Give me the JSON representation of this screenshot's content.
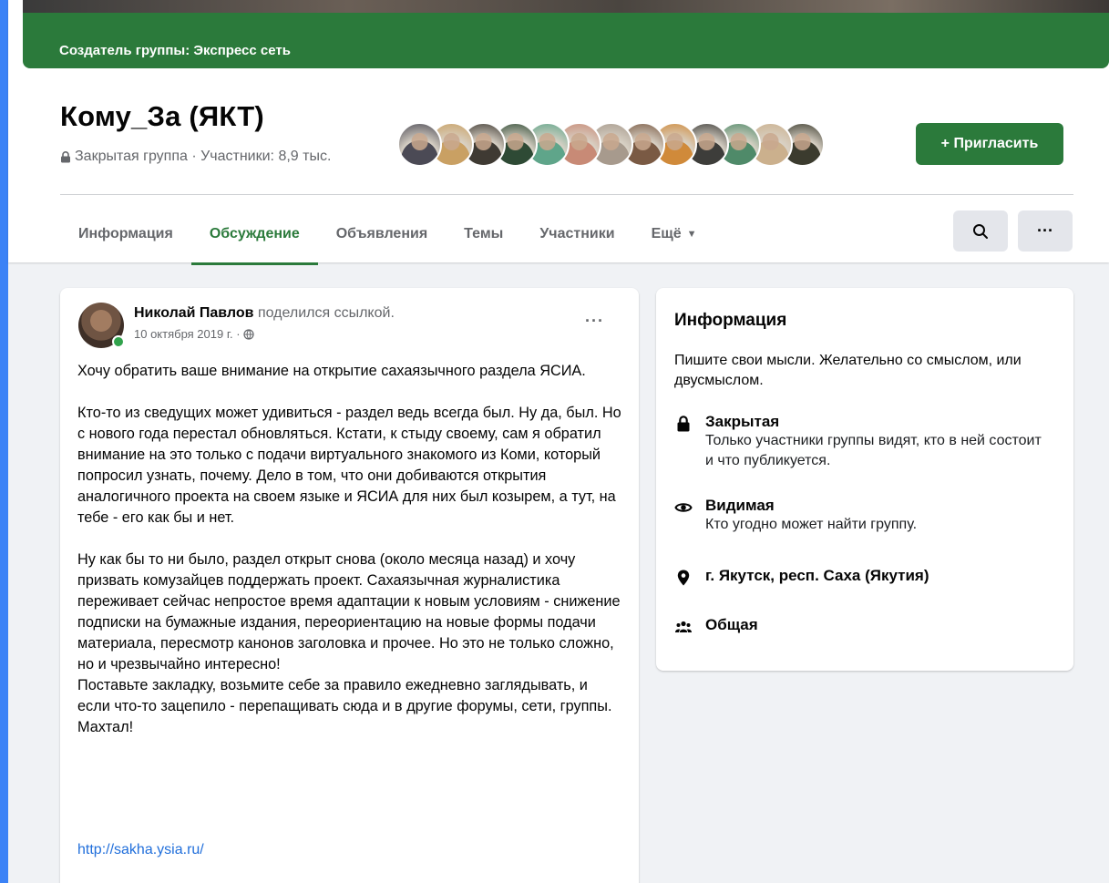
{
  "creator_bar": {
    "text": "Создатель группы: Экспресс сеть"
  },
  "group": {
    "title": "Кому_За (ЯКТ)",
    "meta": "Закрытая группа · Участники: 8,9 тыс.",
    "invite_label": "+ Пригласить"
  },
  "avatar_colors": [
    "#4b4a55",
    "#c9a063",
    "#3f3a33",
    "#2e4a35",
    "#5fa58a",
    "#c88a76",
    "#a79a8d",
    "#7a5a44",
    "#d08a3a",
    "#3d3d3a",
    "#4f8a69",
    "#cbb08d",
    "#3b3b2e"
  ],
  "tabs": [
    {
      "label": "Информация"
    },
    {
      "label": "Обсуждение"
    },
    {
      "label": "Объявления"
    },
    {
      "label": "Темы"
    },
    {
      "label": "Участники"
    },
    {
      "label": "Ещё"
    }
  ],
  "post": {
    "author": "Николай Павлов",
    "action": "поделился ссылкой.",
    "date": "10 октября 2019 г. ·",
    "paragraphs": [
      "Хочу обратить ваше внимание на открытие сахаязычного раздела ЯСИА.",
      "Кто-то из сведущих может удивиться - раздел ведь всегда был. Ну да, был. Но с нового года перестал обновляться. Кстати, к стыду своему, сам я обратил внимание на это только с подачи виртуального знакомого из Коми, который попросил узнать, почему. Дело в том, что они добиваются открытия аналогичного проекта на своем языке и ЯСИА для них был козырем, а тут, на тебе - его как бы и нет.",
      "Ну как бы то ни было, раздел открыт снова (около месяца назад) и хочу призвать комузайцев поддержать проект. Сахаязычная журналистика переживает сейчас непростое время адаптации к новым условиям - снижение подписки на бумажные издания, переориентацию на новые формы подачи материала, пересмотр канонов заголовка и прочее. Но это не только сложно, но и чрезвычайно интересно!",
      "Поставьте закладку, возьмите себе за правило ежедневно заглядывать, и если что-то зацепило - перепащивать сюда и в другие форумы, сети, группы. Махтал!"
    ],
    "link": "http://sakha.ysia.ru/"
  },
  "info": {
    "title": "Информация",
    "description": "Пишите свои мысли. Желательно со смыслом, или двусмыслом.",
    "privacy_title": "Закрытая",
    "privacy_text": "Только участники группы видят, кто в ней состоит и что публикуется.",
    "visibility_title": "Видимая",
    "visibility_text": "Кто угодно может найти группу.",
    "location": "г. Якутск, респ. Саха (Якутия)",
    "type": "Общая"
  },
  "colors": {
    "accent": "#2b7a3b",
    "link": "#216fdb",
    "muted": "#65676b"
  }
}
